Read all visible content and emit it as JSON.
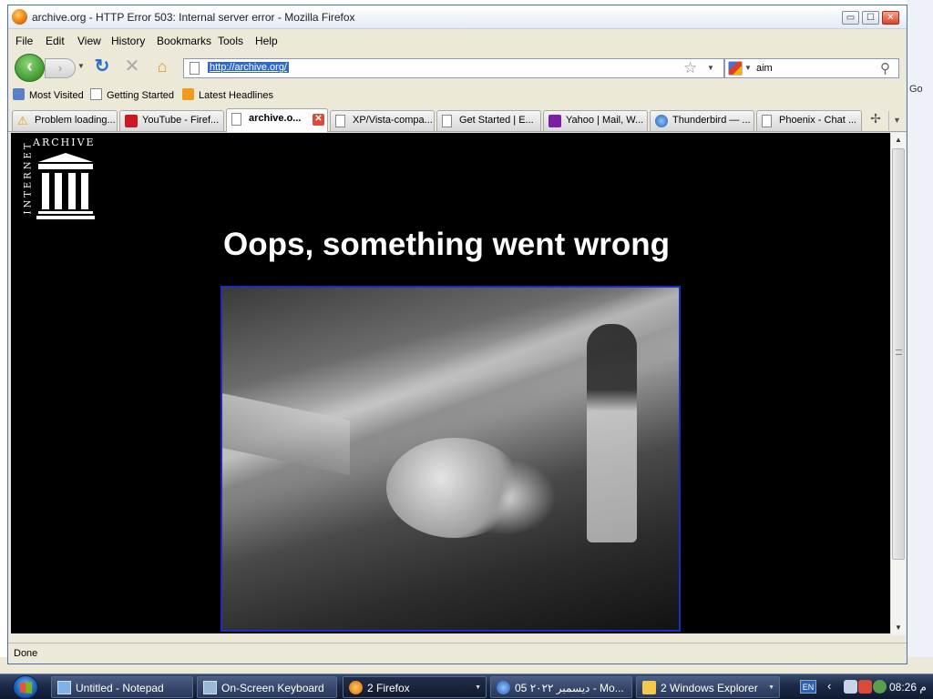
{
  "window": {
    "title": "archive.org - HTTP Error 503: Internal server error - Mozilla Firefox"
  },
  "window_controls": {
    "minimize": "▭",
    "maximize": "☐",
    "close": "✕"
  },
  "menu": [
    "File",
    "Edit",
    "View",
    "History",
    "Bookmarks",
    "Tools",
    "Help"
  ],
  "nav": {
    "back": "‹",
    "forward": "›",
    "reload": "↻",
    "stop": "✕",
    "home": "⌂"
  },
  "address": {
    "url": "http://archive.org/"
  },
  "search": {
    "query": "aim",
    "engine_icon": "google-icon"
  },
  "bookmarks": [
    {
      "label": "Most Visited",
      "icon": "most-visited-icon"
    },
    {
      "label": "Getting Started",
      "icon": "page-icon"
    },
    {
      "label": "Latest Headlines",
      "icon": "rss-icon"
    }
  ],
  "tabs": [
    {
      "label": "Problem loading...",
      "icon": "warning-icon"
    },
    {
      "label": "YouTube - Firef...",
      "icon": "youtube-icon"
    },
    {
      "label": "archive.o...",
      "icon": "page-icon",
      "active": true
    },
    {
      "label": "XP/Vista-compa...",
      "icon": "page-icon"
    },
    {
      "label": "Get Started | E...",
      "icon": "page-icon"
    },
    {
      "label": "Yahoo | Mail, W...",
      "icon": "yahoo-icon"
    },
    {
      "label": "Thunderbird — ...",
      "icon": "thunderbird-icon"
    },
    {
      "label": "Phoenix - Chat ...",
      "icon": "page-icon"
    }
  ],
  "page": {
    "logo_word_top": "ARCHIVE",
    "logo_word_side": "INTERNET",
    "heading": "Oops, something went wrong"
  },
  "status": {
    "text": "Done"
  },
  "background": {
    "go_label": "Go"
  },
  "taskbar": {
    "tasks": [
      {
        "label": "Untitled - Notepad",
        "icon": "notepad-icon"
      },
      {
        "label": "On-Screen Keyboard",
        "icon": "keyboard-icon"
      },
      {
        "label": "2 Firefox",
        "icon": "firefox-icon",
        "active": true
      },
      {
        "label": "05 ديسمبر ٢٠٢٢ - Mo...",
        "icon": "thunderbird-icon"
      },
      {
        "label": "2 Windows Explorer",
        "icon": "folder-icon"
      }
    ],
    "language": "EN",
    "clock": "08:26 م"
  },
  "colors": {
    "content_bg": "#000000",
    "photo_border": "#1a2ec0",
    "url_highlight": "#3169c6"
  }
}
